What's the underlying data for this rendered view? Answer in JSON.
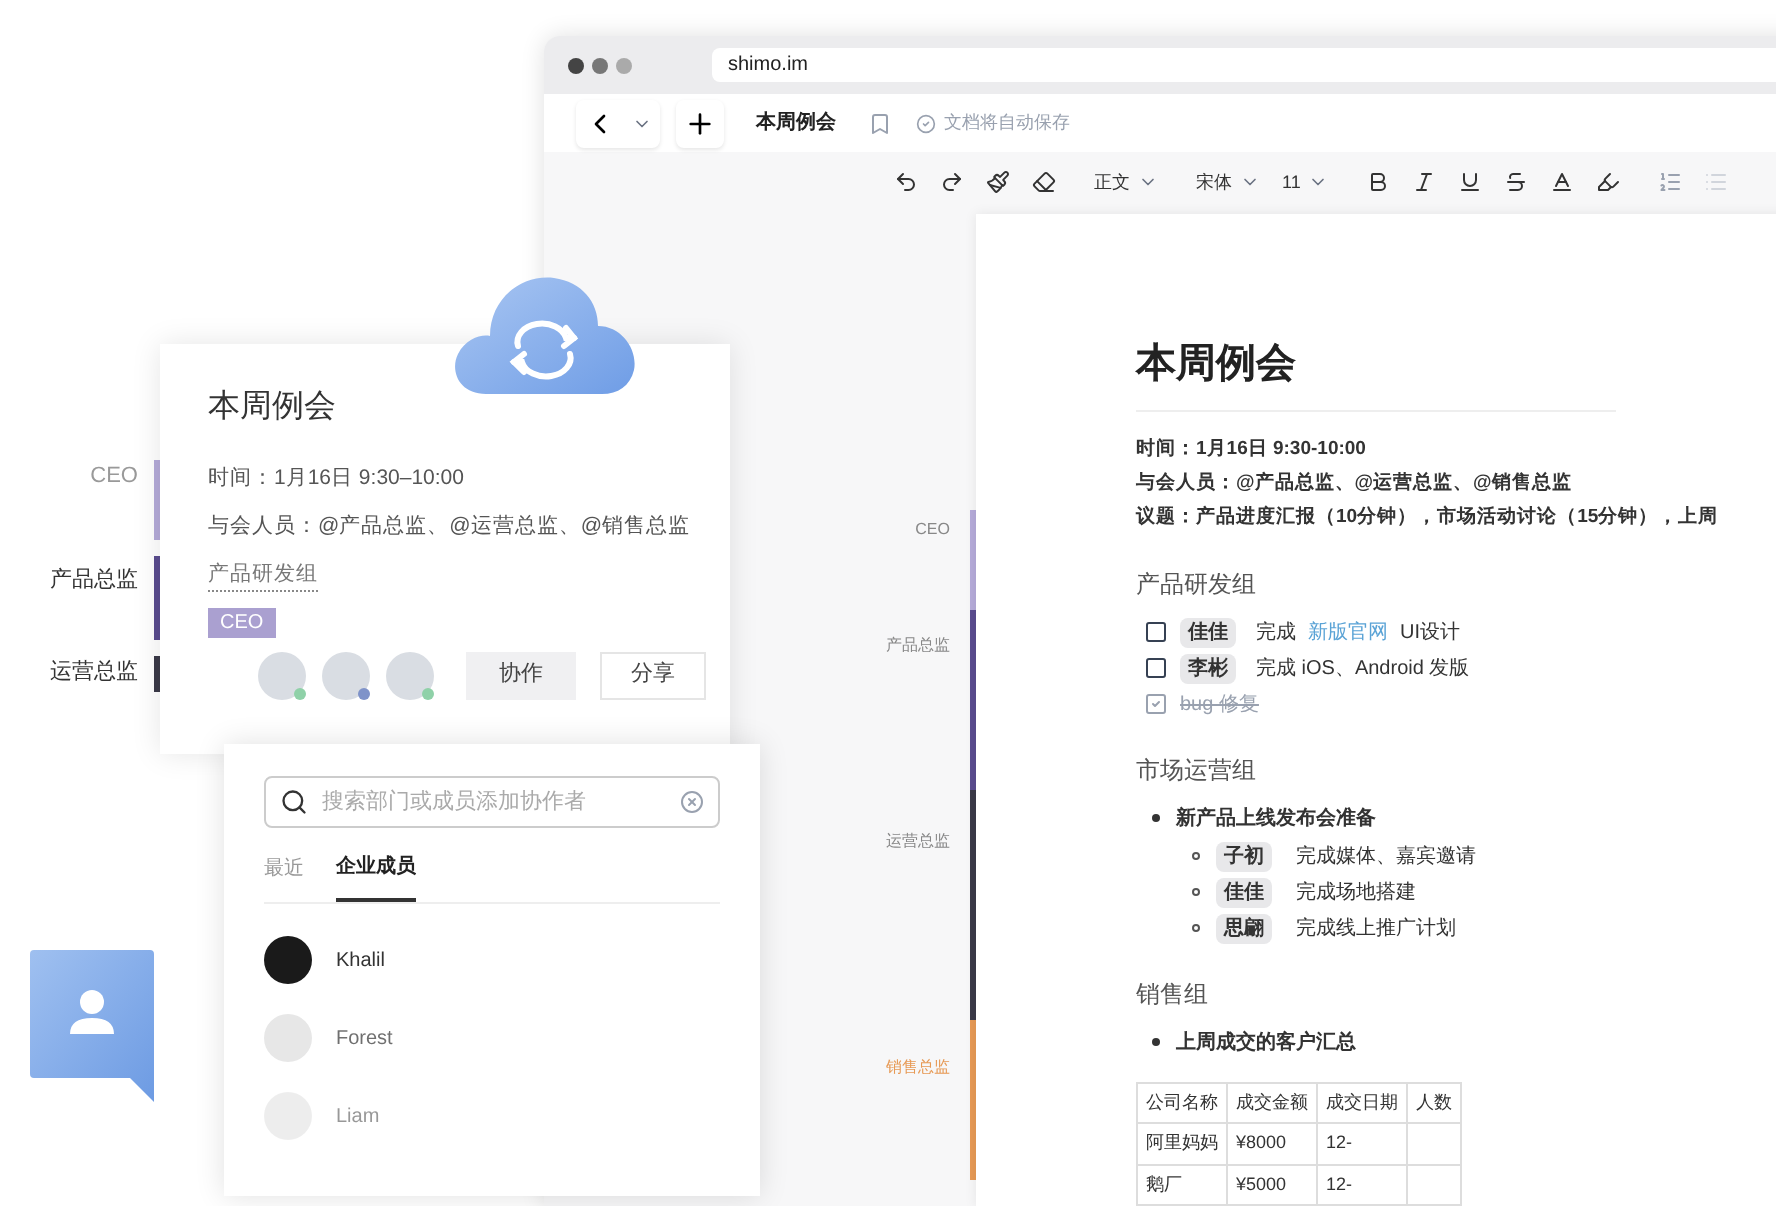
{
  "browser": {
    "address": "shimo.im",
    "doc_title": "本周例会",
    "save_status": "文档将自动保存",
    "format": {
      "style": "正文",
      "font": "宋体",
      "size": "11"
    },
    "outline": [
      {
        "label": "CEO",
        "color": "#b5abd9"
      },
      {
        "label": "产品总监",
        "color": "#5a4c8f"
      },
      {
        "label": "运营总监",
        "color": "#3b3a48"
      },
      {
        "label": "销售总监",
        "color": "#e79a55"
      }
    ],
    "document": {
      "title": "本周例会",
      "meta": [
        "时间：1月16日 9:30-10:00",
        "与会人员：@产品总监、@运营总监、@销售总监",
        "议题：产品进度汇报（10分钟），市场活动讨论（15分钟），上周"
      ],
      "sections": [
        {
          "kind": "tasks",
          "heading": "产品研发组",
          "tasks": [
            {
              "assignee": "佳佳",
              "before": "完成",
              "link": "新版官网",
              "after": "UI设计",
              "checked": false
            },
            {
              "assignee": "李彬",
              "before": "完成 iOS、Android 发版",
              "checked": false
            },
            {
              "before": "bug 修复",
              "checked": true
            }
          ]
        },
        {
          "kind": "bullets",
          "heading": "市场运营组",
          "bullet": "新产品上线发布会准备",
          "subitems": [
            {
              "assignee": "子初",
              "text": "完成媒体、嘉宾邀请"
            },
            {
              "assignee": "佳佳",
              "text": "完成场地搭建"
            },
            {
              "assignee": "思翩",
              "text": "完成线上推广计划"
            }
          ]
        },
        {
          "kind": "table",
          "heading": "销售组",
          "bullet": "上周成交的客户汇总",
          "table": {
            "columns": [
              "公司名称",
              "成交金额",
              "成交日期",
              "人数"
            ],
            "rows": [
              [
                "阿里妈妈",
                "¥8000",
                "12-"
              ],
              [
                "鹅厂",
                "¥5000",
                "12-"
              ]
            ]
          }
        }
      ]
    }
  },
  "card": {
    "title": "本周例会",
    "time": "时间：1月16日 9:30–10:00",
    "attendees": "与会人员：@产品总监、@运营总监、@销售总监",
    "group": "产品研发组",
    "tag": "CEO",
    "outline": [
      {
        "label": "CEO",
        "color": "#b5abd9"
      },
      {
        "label": "产品总监",
        "color": "#5a4c8f"
      },
      {
        "label": "运营总监",
        "color": "#3b3a48"
      }
    ],
    "avatars": [
      {
        "color": "#8fd1a8"
      },
      {
        "color": "#7f93c9"
      },
      {
        "color": "#8fd1a8"
      }
    ],
    "buttons": [
      "协作",
      "分享"
    ]
  },
  "picker": {
    "placeholder": "搜索部门或成员添加协作者",
    "tabs": [
      {
        "label": "最近",
        "selected": false
      },
      {
        "label": "企业成员",
        "selected": true
      }
    ],
    "members": [
      "Khalil",
      "Forest",
      "Liam"
    ]
  }
}
